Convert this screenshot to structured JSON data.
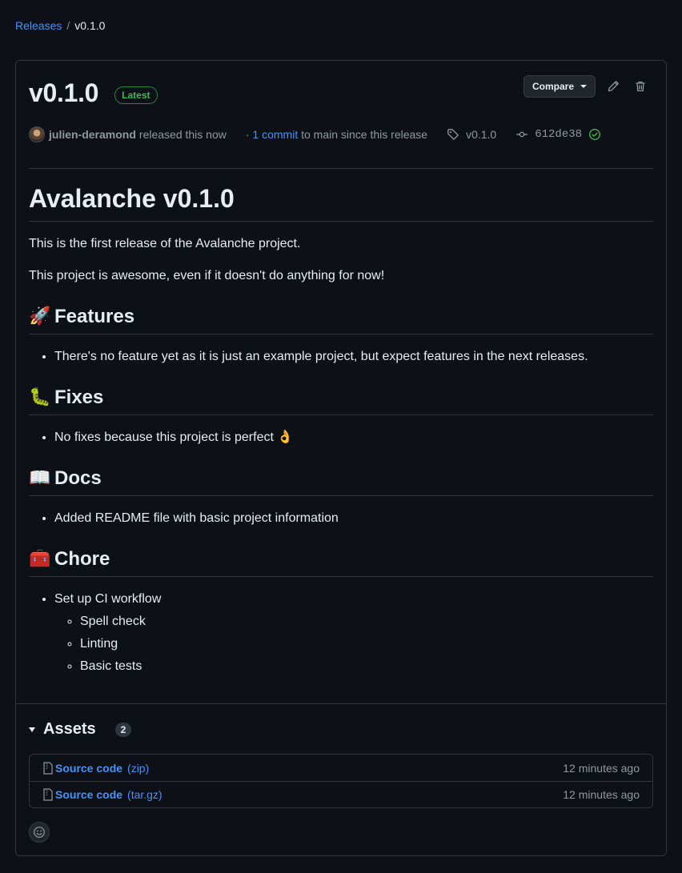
{
  "breadcrumb": {
    "parent": "Releases",
    "separator": "/",
    "current": "v0.1.0"
  },
  "release": {
    "title": "v0.1.0",
    "badge": "Latest",
    "compare_label": "Compare",
    "author": "julien-deramond",
    "released_text": "released this now",
    "commits_link": "1 commit",
    "commits_suffix": "to main since this release",
    "commits_prefix": "·",
    "tag": "v0.1.0",
    "commit_sha": "612de38",
    "icons": {
      "edit": "pencil-icon",
      "delete": "trash-icon",
      "tag": "tag-icon",
      "commit": "git-commit-icon",
      "verified": "check-circle-icon"
    }
  },
  "notes": {
    "heading": "Avalanche v0.1.0",
    "paragraphs": [
      "This is the first release of the Avalanche project.",
      "This project is awesome, even if it doesn't do anything for now!"
    ],
    "sections": [
      {
        "emoji": "🚀",
        "title": "Features",
        "items": [
          "There's no feature yet as it is just an example project, but expect features in the next releases."
        ]
      },
      {
        "emoji": "🐛",
        "title": "Fixes",
        "items": [
          "No fixes because this project is perfect 👌"
        ]
      },
      {
        "emoji": "📖",
        "title": "Docs",
        "items": [
          "Added README file with basic project information"
        ]
      },
      {
        "emoji": "🧰",
        "title": "Chore",
        "items": [
          "Set up CI workflow"
        ],
        "subitems": [
          "Spell check",
          "Linting",
          "Basic tests"
        ]
      }
    ]
  },
  "assets": {
    "title": "Assets",
    "count": "2",
    "rows": [
      {
        "name": "Source code",
        "format": "(zip)",
        "time": "12 minutes ago"
      },
      {
        "name": "Source code",
        "format": "(tar.gz)",
        "time": "12 minutes ago"
      }
    ]
  },
  "colors": {
    "background": "#0d1117",
    "link": "#4493f8",
    "success": "#3fb950",
    "border": "#30363d"
  }
}
